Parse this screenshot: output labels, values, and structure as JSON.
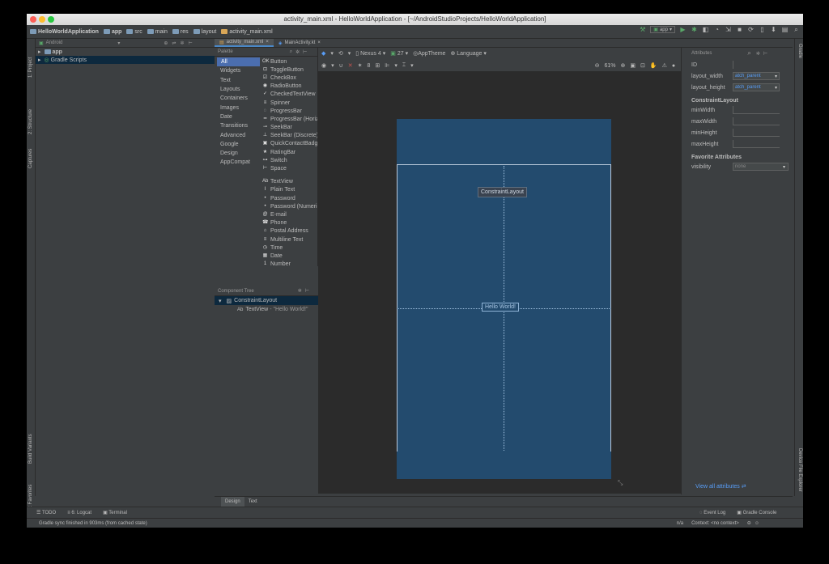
{
  "window": {
    "title": "activity_main.xml - HelloWorldApplication - [~/AndroidStudioProjects/HelloWorldApplication]"
  },
  "breadcrumbs": [
    "HelloWorldApplication",
    "app",
    "src",
    "main",
    "res",
    "layout",
    "activity_main.xml"
  ],
  "toolbar": {
    "run_config": "app",
    "icons": [
      "build-icon",
      "run-icon",
      "debug-icon",
      "profile-icon",
      "sdk-manager-icon",
      "avd-manager-icon",
      "search-icon"
    ]
  },
  "left_strip": [
    "1: Project",
    "2: Structure",
    "Captures",
    "Build Variants",
    "2: Favorites"
  ],
  "right_strip": [
    "Gradle",
    "Device File Explorer"
  ],
  "project": {
    "view_mode": "Android",
    "items": [
      {
        "label": "app"
      },
      {
        "label": "Gradle Scripts"
      }
    ]
  },
  "editor_tabs": [
    {
      "label": "activity_main.xml",
      "active": true
    },
    {
      "label": "MainActivity.kt",
      "active": false
    }
  ],
  "palette": {
    "header": "Palette",
    "categories": [
      "All",
      "Widgets",
      "Text",
      "Layouts",
      "Containers",
      "Images",
      "Date",
      "Transitions",
      "Advanced",
      "Google",
      "Design",
      "AppCompat"
    ],
    "selected_category": "All",
    "widgets": [
      {
        "icon": "OK",
        "label": "Button"
      },
      {
        "icon": "⊡",
        "label": "ToggleButton"
      },
      {
        "icon": "☑",
        "label": "CheckBox"
      },
      {
        "icon": "◉",
        "label": "RadioButton"
      },
      {
        "icon": "✓",
        "label": "CheckedTextView"
      },
      {
        "icon": "≡",
        "label": "Spinner"
      },
      {
        "icon": "◌",
        "label": "ProgressBar"
      },
      {
        "icon": "━",
        "label": "ProgressBar (Horizontal)"
      },
      {
        "icon": "⊸",
        "label": "SeekBar"
      },
      {
        "icon": "⊥",
        "label": "SeekBar (Discrete)"
      },
      {
        "icon": "▣",
        "label": "QuickContactBadge"
      },
      {
        "icon": "★",
        "label": "RatingBar"
      },
      {
        "icon": "⊶",
        "label": "Switch"
      },
      {
        "icon": "⊢",
        "label": "Space"
      }
    ],
    "text_widgets": [
      {
        "icon": "Ab",
        "label": "TextView"
      },
      {
        "icon": "I",
        "label": "Plain Text"
      },
      {
        "icon": "•",
        "label": "Password"
      },
      {
        "icon": "•",
        "label": "Password (Numeric)"
      },
      {
        "icon": "@",
        "label": "E-mail"
      },
      {
        "icon": "☎",
        "label": "Phone"
      },
      {
        "icon": "⌂",
        "label": "Postal Address"
      },
      {
        "icon": "≡",
        "label": "Multiline Text"
      },
      {
        "icon": "◷",
        "label": "Time"
      },
      {
        "icon": "▦",
        "label": "Date"
      },
      {
        "icon": "1",
        "label": "Number"
      }
    ]
  },
  "component_tree": {
    "header": "Component Tree",
    "root": "ConstraintLayout",
    "child": "TextView",
    "child_text": "- \"Hello World!\""
  },
  "design_toolbar": {
    "device": "Nexus 4",
    "api": "27",
    "theme": "AppTheme",
    "language": "Language",
    "zoom": "61%"
  },
  "canvas": {
    "constraint_label": "ConstraintLayout",
    "textview_label": "Hello World!"
  },
  "attributes": {
    "header": "Attributes",
    "rows": [
      {
        "key": "ID",
        "value": ""
      },
      {
        "key": "layout_width",
        "value": "atch_parent"
      },
      {
        "key": "layout_height",
        "value": "atch_parent"
      }
    ],
    "section1": "ConstraintLayout",
    "constraint_rows": [
      {
        "key": "minWidth",
        "value": ""
      },
      {
        "key": "maxWidth",
        "value": ""
      },
      {
        "key": "minHeight",
        "value": ""
      },
      {
        "key": "maxHeight",
        "value": ""
      }
    ],
    "section2": "Favorite Attributes",
    "favorite_rows": [
      {
        "key": "visibility",
        "value": "none"
      }
    ],
    "view_all": "View all attributes"
  },
  "bottom_tabs": [
    {
      "label": "Design",
      "active": true
    },
    {
      "label": "Text",
      "active": false
    }
  ],
  "tool_windows": {
    "left": [
      "TODO",
      "6: Logcat",
      "Terminal"
    ],
    "right": [
      "Event Log",
      "Gradle Console"
    ]
  },
  "status": {
    "message": "Gradle sync finished in 903ms (from cached state)",
    "right": "n/a",
    "context": "Context: <no context>"
  }
}
